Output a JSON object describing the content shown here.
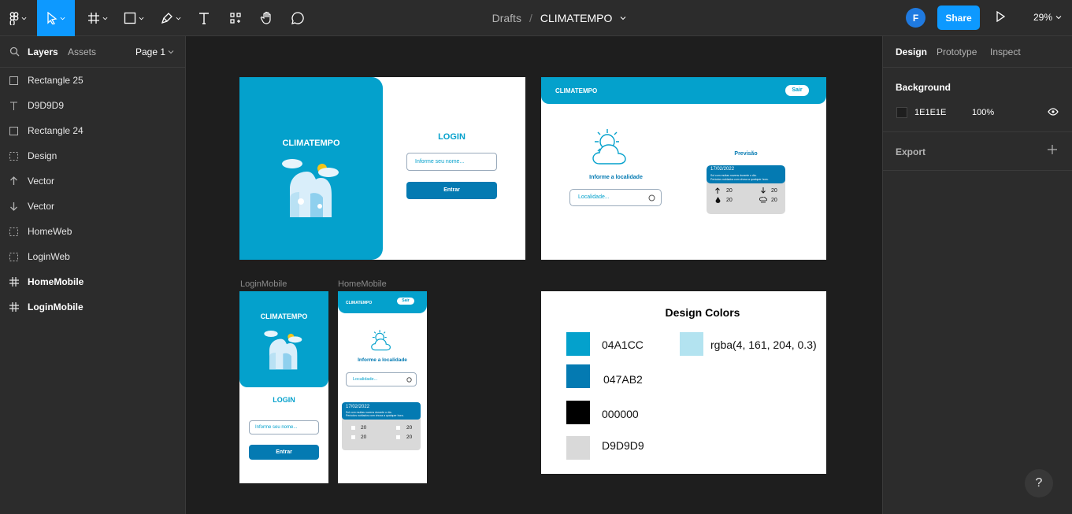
{
  "toolbar": {
    "file_location": "Drafts",
    "file_name": "CLIMATEMPO",
    "avatar_initial": "F",
    "share_label": "Share",
    "zoom_level": "29%"
  },
  "left_panel": {
    "tabs": {
      "layers": "Layers",
      "assets": "Assets"
    },
    "page_selector": "Page 1",
    "layers": [
      {
        "label": "Rectangle 25",
        "icon": "rectangle-icon"
      },
      {
        "label": "D9D9D9",
        "icon": "text-icon"
      },
      {
        "label": "Rectangle 24",
        "icon": "rectangle-icon"
      },
      {
        "label": "Design",
        "icon": "dashed-frame-icon"
      },
      {
        "label": "Vector",
        "icon": "arrow-up-icon"
      },
      {
        "label": "Vector",
        "icon": "arrow-down-icon"
      },
      {
        "label": "HomeWeb",
        "icon": "dashed-frame-icon"
      },
      {
        "label": "LoginWeb",
        "icon": "dashed-frame-icon"
      },
      {
        "label": "HomeMobile",
        "icon": "frame-hash-icon"
      },
      {
        "label": "LoginMobile",
        "icon": "frame-hash-icon"
      }
    ]
  },
  "right_panel": {
    "tabs": {
      "design": "Design",
      "prototype": "Prototype",
      "inspect": "Inspect"
    },
    "background": {
      "title": "Background",
      "color_hex": "1E1E1E",
      "opacity": "100%",
      "swatch": "#1e1e1e"
    },
    "export": {
      "title": "Export"
    }
  },
  "canvas": {
    "frame_labels": {
      "login_mobile": "LoginMobile",
      "home_mobile": "HomeMobile"
    },
    "login_web": {
      "brand": "CLIMATEMPO",
      "login_title": "LOGIN",
      "name_placeholder": "Informe seu nome...",
      "enter_button": "Entrar"
    },
    "home_web": {
      "brand": "CLIMATEMPO",
      "logout_button": "Sair",
      "location_prompt": "Informe a localidade",
      "location_placeholder": "Localidade...",
      "forecast_title": "Previsão",
      "forecast_date": "17/02/2022",
      "forecast_text_1": "Sol com muitas nuvens durante o dia.",
      "forecast_text_2": "Períodos nublados com chuva a qualquer hora.",
      "temp_max": "20",
      "temp_min": "20",
      "humidity": "20",
      "rain": "20"
    },
    "login_mobile": {
      "brand": "CLIMATEMPO",
      "login_title": "LOGIN",
      "name_placeholder": "Informe seu nome...",
      "enter_button": "Entrar"
    },
    "home_mobile": {
      "brand": "CLIMATEMPO",
      "logout_button": "Sair",
      "location_prompt": "Informe a localidade",
      "location_placeholder": "Localidade...",
      "forecast_date": "17/02/2022",
      "forecast_text_1": "Sol com muitas nuvens durante o dia.",
      "forecast_text_2": "Períodos nublados com chuva a qualquer hora.",
      "v1": "20",
      "v2": "20",
      "v3": "20",
      "v4": "20"
    },
    "design_colors": {
      "title": "Design Colors",
      "colors": [
        {
          "label": "04A1CC",
          "value": "#04a1cc"
        },
        {
          "label": "047AB2",
          "value": "#047ab2"
        },
        {
          "label": "000000",
          "value": "#000000"
        },
        {
          "label": "D9D9D9",
          "value": "#d9d9d9"
        },
        {
          "label": "rgba(4, 161, 204, 0.3)",
          "value": "rgba(4,161,204,0.3)"
        }
      ]
    }
  },
  "help_label": "?"
}
